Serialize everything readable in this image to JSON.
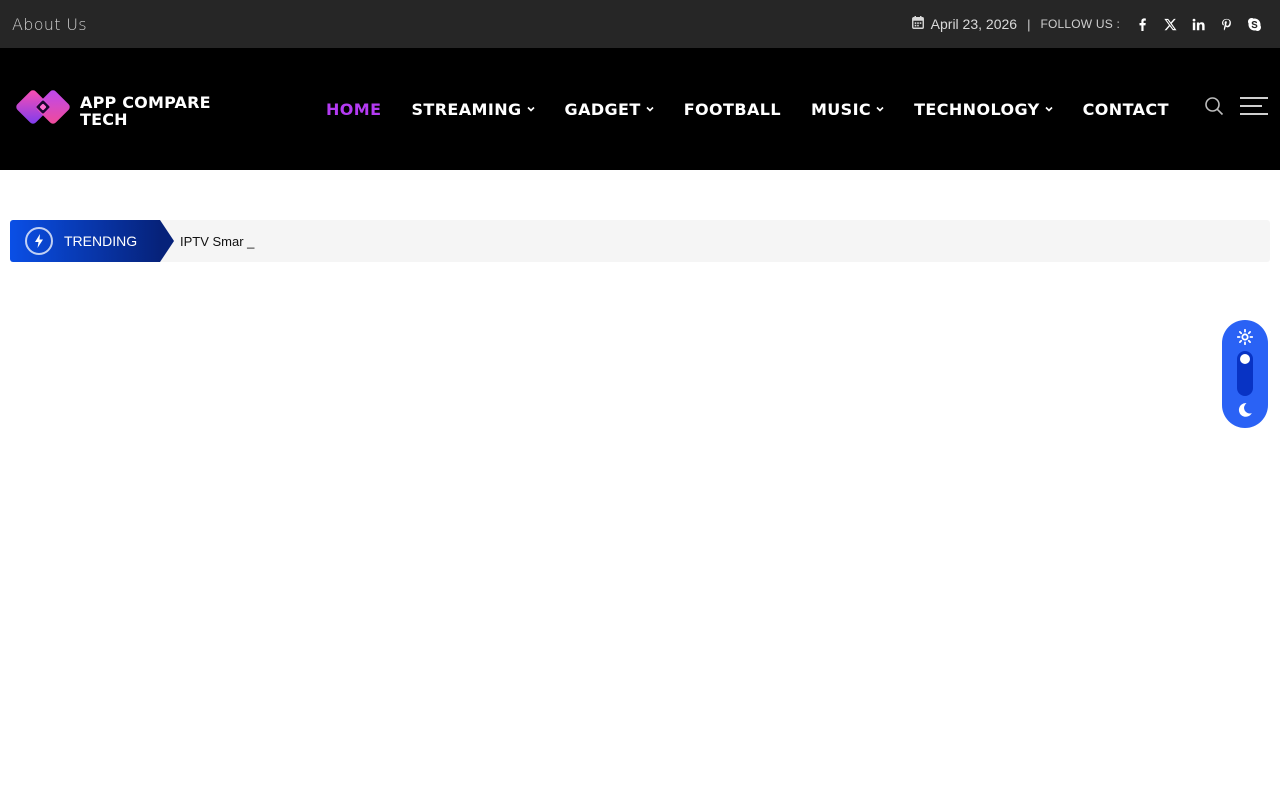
{
  "topbar": {
    "about_label": "About Us",
    "date": "April 23, 2026",
    "separator": "|",
    "follow_label": "FOLLOW US :",
    "social_icons": [
      "facebook-icon",
      "x-twitter-icon",
      "linkedin-icon",
      "pinterest-icon",
      "skype-icon"
    ]
  },
  "header": {
    "logo_line1": "APP COMPARE",
    "logo_line2": "TECH",
    "nav": [
      {
        "label": "HOME",
        "active": true,
        "has_dropdown": false
      },
      {
        "label": "STREAMING",
        "active": false,
        "has_dropdown": true
      },
      {
        "label": "GADGET",
        "active": false,
        "has_dropdown": true
      },
      {
        "label": "FOOTBALL",
        "active": false,
        "has_dropdown": false
      },
      {
        "label": "MUSIC",
        "active": false,
        "has_dropdown": true
      },
      {
        "label": "TECHNOLOGY",
        "active": false,
        "has_dropdown": true
      },
      {
        "label": "CONTACT",
        "active": false,
        "has_dropdown": false
      }
    ],
    "tools": [
      "search-icon",
      "menu-icon"
    ]
  },
  "trending": {
    "label": "TRENDING",
    "ticker_text": "IPTV Smar _"
  },
  "mode_toggle": {
    "icons": [
      "sun-icon",
      "moon-icon"
    ],
    "current": "light"
  },
  "colors": {
    "topbar_bg": "#262626",
    "header_bg": "#000000",
    "nav_active": "#b43bf2",
    "accent_blue": "#2a62f5",
    "trending_dark": "#06227a"
  }
}
